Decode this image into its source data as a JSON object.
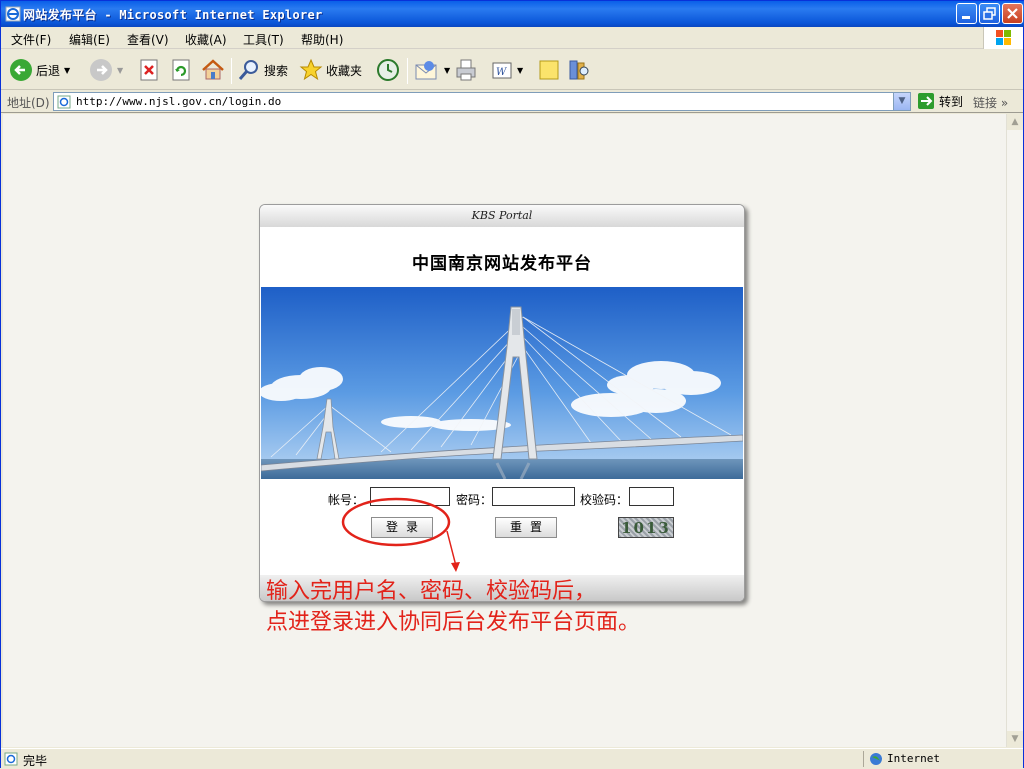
{
  "window": {
    "title": "网站发布平台 - Microsoft Internet Explorer",
    "buttons": {
      "minimize": "_",
      "maximize": "❐",
      "close": "✕"
    }
  },
  "menu": [
    "文件(F)",
    "编辑(E)",
    "查看(V)",
    "收藏(A)",
    "工具(T)",
    "帮助(H)"
  ],
  "toolbar": {
    "back": "后退",
    "search": "搜索",
    "favorites": "收藏夹"
  },
  "address": {
    "label": "地址(D)",
    "url": "http://www.njsl.gov.cn/login.do",
    "go": "转到",
    "links": "链接"
  },
  "portal": {
    "header": "KBS Portal",
    "title": "中国南京网站发布平台",
    "form": {
      "account_label": "帐号：",
      "password_label": "密码：",
      "captcha_label": "校验码：",
      "account_value": "",
      "password_value": "",
      "captcha_value": ""
    },
    "login_button": "登录",
    "reset_button": "重置",
    "captcha_text": "1013"
  },
  "annotation": {
    "line1": "输入完用户名、密码、校验码后，",
    "line2": "点进登录进入协同后台发布平台页面。",
    "color": "#e2231a"
  },
  "status": {
    "left": "完毕",
    "zone": "Internet"
  },
  "colors": {
    "titlebar": "#0a55d8",
    "chrome": "#ece9d8",
    "annotation": "#e2231a"
  }
}
